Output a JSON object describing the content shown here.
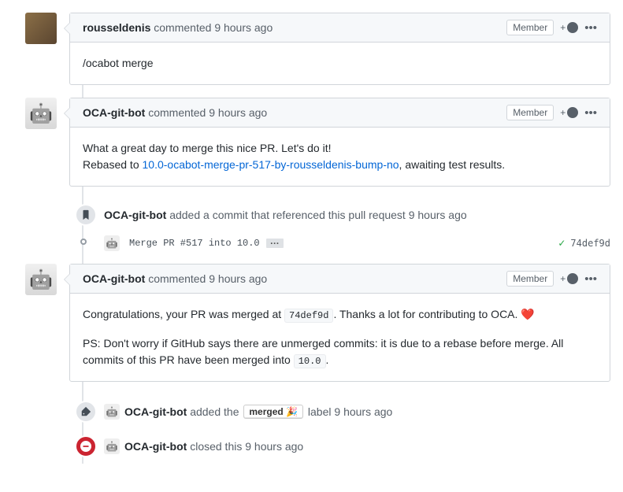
{
  "comments": [
    {
      "author": "rousseldenis",
      "action": "commented",
      "time": "9 hours ago",
      "badge": "Member",
      "body": "/ocabot merge"
    },
    {
      "author": "OCA-git-bot",
      "action": "commented",
      "time": "9 hours ago",
      "badge": "Member",
      "body_line1_a": "What a great day to merge this nice PR. Let's do it!",
      "body_line2_a": "Rebased to ",
      "body_line2_link": "10.0-ocabot-merge-pr-517-by-rousseldenis-bump-no",
      "body_line2_b": ", awaiting test results."
    },
    {
      "author": "OCA-git-bot",
      "action": "commented",
      "time": "9 hours ago",
      "badge": "Member",
      "body_p1_a": "Congratulations, your PR was merged at ",
      "body_p1_code": "74def9d",
      "body_p1_b": ". Thanks a lot for contributing to OCA. ",
      "body_p2_a": "PS: Don't worry if GitHub says there are unmerged commits: it is due to a rebase before merge. All commits of this PR have been merged into ",
      "body_p2_code": "10.0",
      "body_p2_b": "."
    }
  ],
  "events": {
    "ref_commit": {
      "author": "OCA-git-bot",
      "action": "added a commit that referenced this pull request",
      "time": "9 hours ago",
      "commit_msg": "Merge PR #517 into 10.0",
      "sha": "74def9d"
    },
    "label": {
      "author": "OCA-git-bot",
      "pre": "added the",
      "label_text": "merged 🎉",
      "post": "label",
      "time": "9 hours ago"
    },
    "closed": {
      "author": "OCA-git-bot",
      "action": "closed this",
      "time": "9 hours ago"
    }
  },
  "heart": "❤️"
}
